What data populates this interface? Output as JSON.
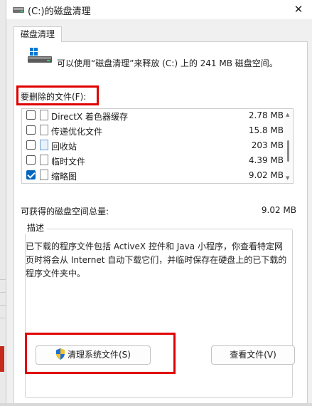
{
  "window": {
    "title": "(C:)的磁盘清理"
  },
  "tabs": [
    {
      "label": "磁盘清理"
    }
  ],
  "intro": {
    "text": "可以使用“磁盘清理”来释放  (C:) 上的 241 MB 磁盘空间。"
  },
  "files": {
    "label": "要删除的文件(F):",
    "items": [
      {
        "name": "DirectX 着色器缓存",
        "size": "2.78 MB",
        "checked": false,
        "icon": "file-icon"
      },
      {
        "name": "传递优化文件",
        "size": "15.8 MB",
        "checked": false,
        "icon": "file-icon"
      },
      {
        "name": "回收站",
        "size": "203 MB",
        "checked": false,
        "icon": "recycle-bin-icon"
      },
      {
        "name": "临时文件",
        "size": "4.39 MB",
        "checked": false,
        "icon": "file-icon"
      },
      {
        "name": "缩略图",
        "size": "9.02 MB",
        "checked": true,
        "icon": "file-icon"
      }
    ]
  },
  "total": {
    "label": "可获得的磁盘空间总量:",
    "value": "9.02 MB"
  },
  "description": {
    "title": "描述",
    "text": "已下载的程序文件包括 ActiveX 控件和 Java 小程序，你查看特定网页时将会从 Internet 自动下载它们，并临时保存在硬盘上的已下载的程序文件夹中。"
  },
  "buttons": {
    "clean_system": "清理系统文件(S)",
    "view_files": "查看文件(V)"
  },
  "colors": {
    "highlight": "#e00000",
    "accent": "#0067c0"
  }
}
